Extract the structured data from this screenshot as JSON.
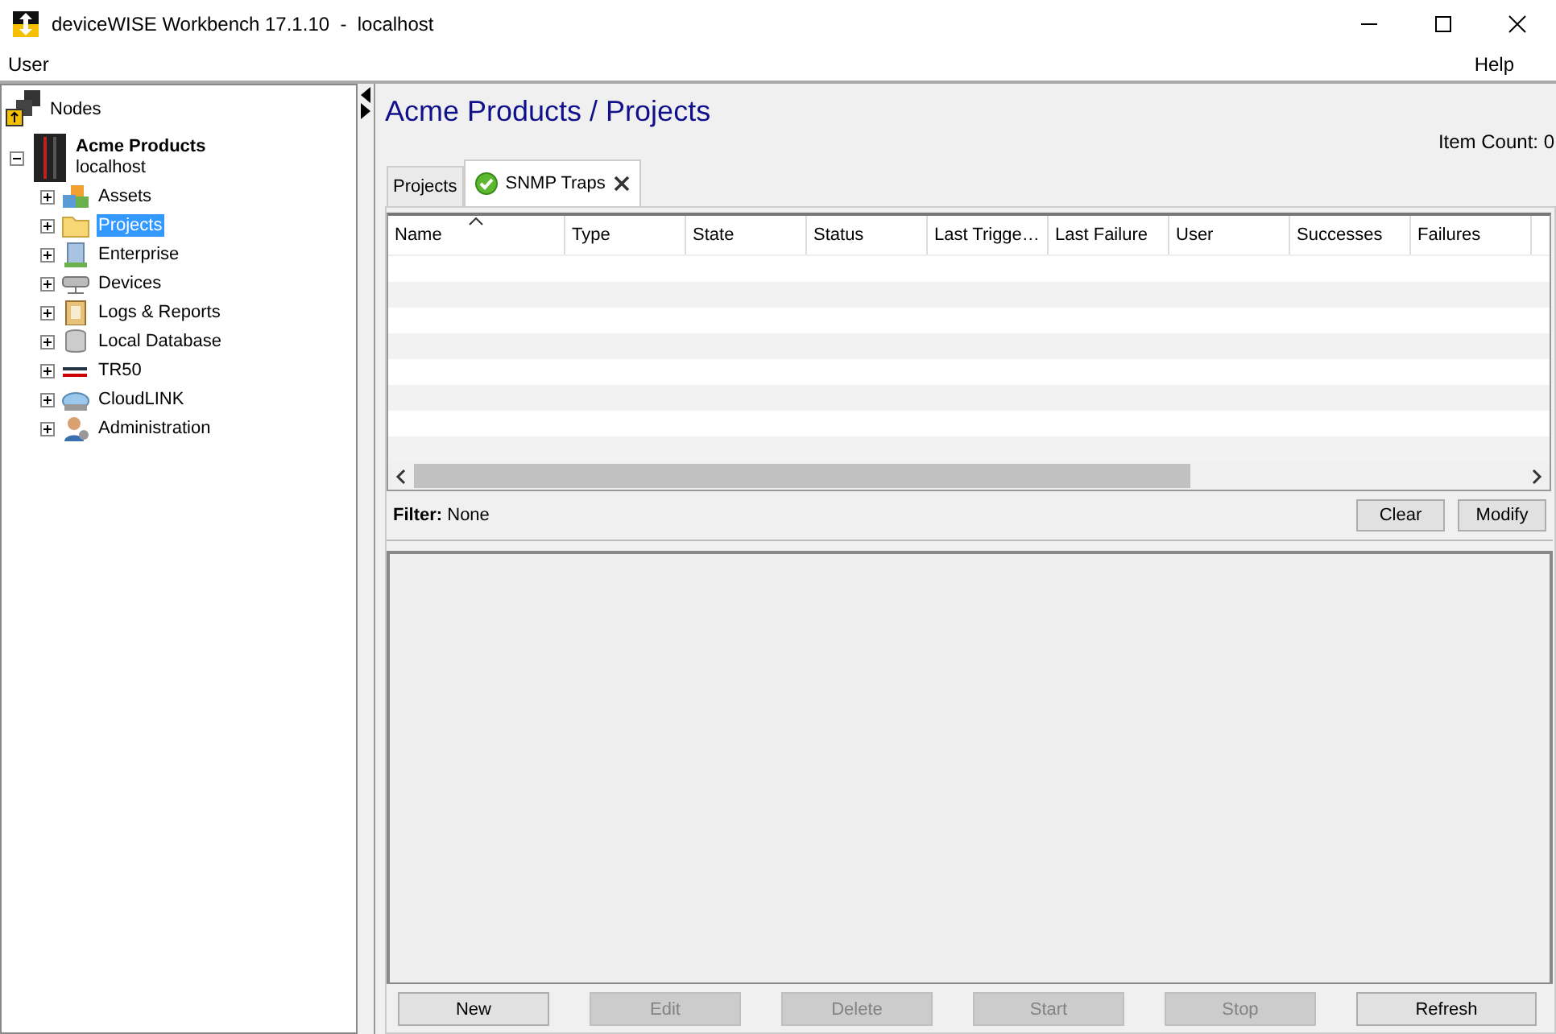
{
  "window": {
    "title": "deviceWISE Workbench 17.1.10  -  localhost"
  },
  "menu": [
    "User",
    "Help"
  ],
  "tree": {
    "root": "Nodes",
    "node": {
      "name": "Acme Products",
      "host": "localhost",
      "expanded": true,
      "children": [
        {
          "label": "Assets",
          "expanded": false,
          "selected": false
        },
        {
          "label": "Projects",
          "expanded": false,
          "selected": true
        },
        {
          "label": "Enterprise",
          "expanded": false,
          "selected": false
        },
        {
          "label": "Devices",
          "expanded": false,
          "selected": false
        },
        {
          "label": "Logs & Reports",
          "expanded": false,
          "selected": false
        },
        {
          "label": "Local Database",
          "expanded": false,
          "selected": false
        },
        {
          "label": "TR50",
          "expanded": false,
          "selected": false
        },
        {
          "label": "CloudLINK",
          "expanded": false,
          "selected": false
        },
        {
          "label": "Administration",
          "expanded": false,
          "selected": false
        }
      ]
    }
  },
  "heading": "Acme Products / Projects",
  "item_count": "Item Count: 0",
  "tabs": [
    {
      "label": "Projects",
      "selected": false,
      "closable": false
    },
    {
      "label": "SNMP Traps",
      "selected": true,
      "closable": true
    }
  ],
  "table": {
    "columns": [
      "Name",
      "Type",
      "State",
      "Status",
      "Last Trigge…",
      "Last Failure",
      "User",
      "Successes",
      "Failures"
    ]
  },
  "filter": {
    "label": "Filter:",
    "value": "None"
  },
  "filter_buttons": [
    {
      "label": "Clear",
      "disabled": false
    },
    {
      "label": "Modify",
      "disabled": false
    }
  ],
  "buttons": [
    {
      "label": "New",
      "disabled": false
    },
    {
      "label": "Edit",
      "disabled": true
    },
    {
      "label": "Delete",
      "disabled": true
    },
    {
      "label": "Start",
      "disabled": true
    },
    {
      "label": "Stop",
      "disabled": true
    },
    {
      "label": "Refresh",
      "disabled": false
    }
  ]
}
